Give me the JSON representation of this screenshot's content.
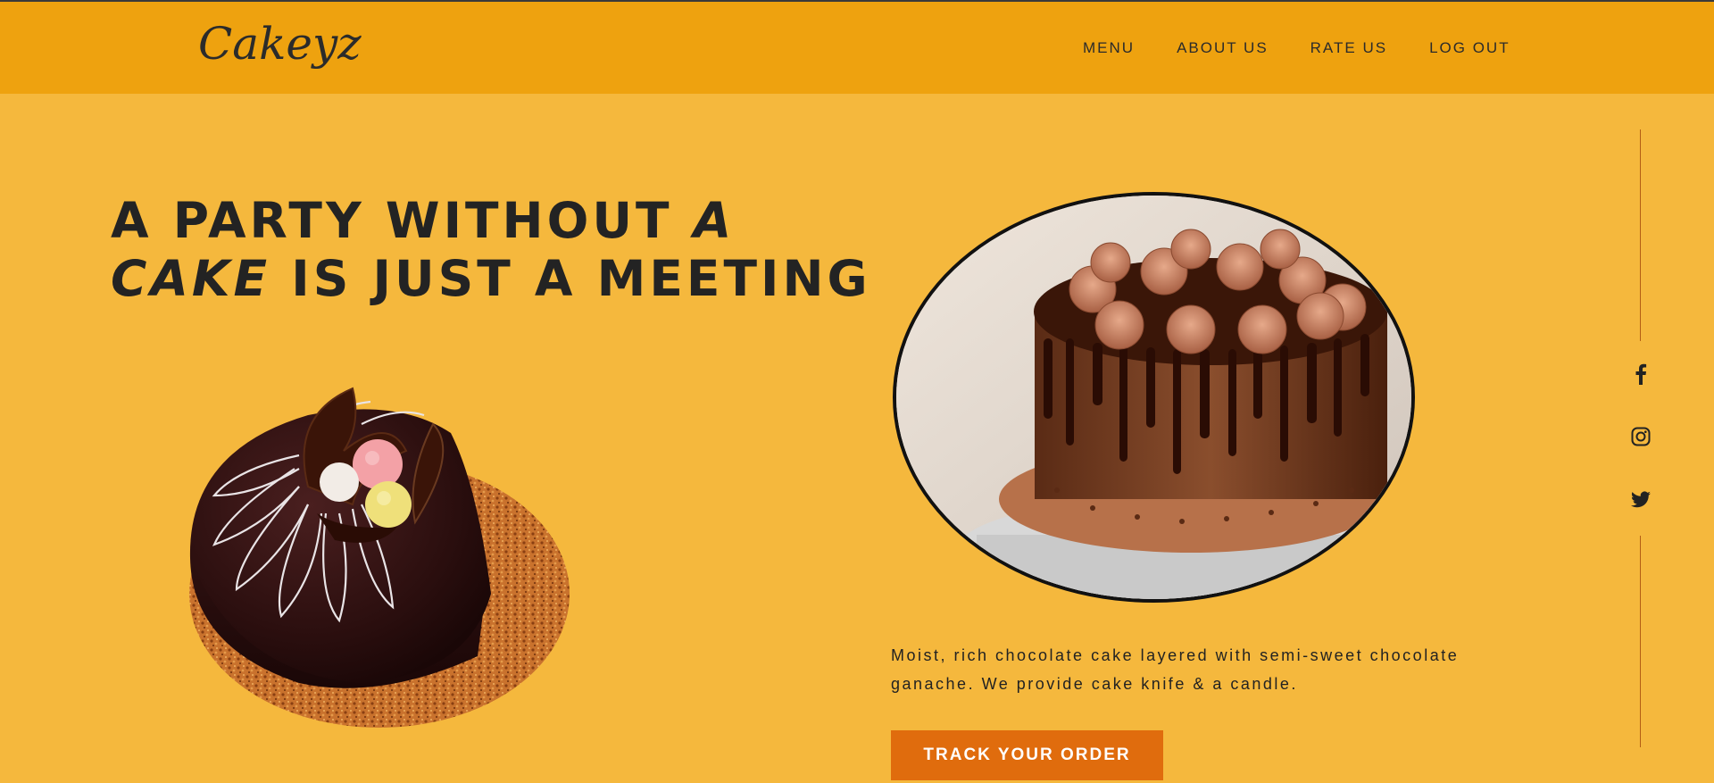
{
  "brand": {
    "logo_text": "Cakeyz"
  },
  "nav": {
    "items": [
      {
        "label": "MENU"
      },
      {
        "label": "ABOUT US"
      },
      {
        "label": "RATE US"
      },
      {
        "label": "LOG OUT"
      }
    ]
  },
  "hero": {
    "headline_line1_a": "A PARTY WITHOUT ",
    "headline_line1_b": "A",
    "headline_line2_a": "CAKE",
    "headline_line2_b": " IS JUST A MEETING",
    "description": "Moist, rich chocolate cake layered with semi-sweet chocolate ganache. We provide cake knife & a candle.",
    "cta_label": "TRACK YOUR ORDER"
  },
  "social": {
    "icons": [
      "facebook-icon",
      "instagram-icon",
      "twitter-icon"
    ]
  },
  "colors": {
    "background": "#f5b83d",
    "header": "#eea20f",
    "button": "#e06c0d",
    "text": "#232323"
  }
}
